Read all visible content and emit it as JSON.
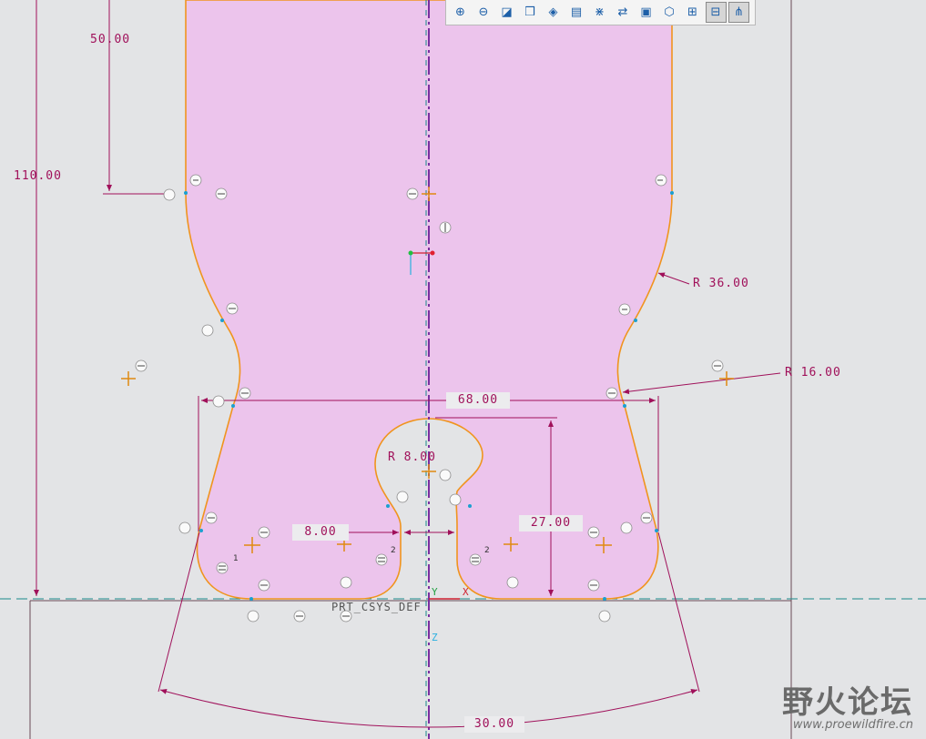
{
  "dimensions": {
    "d50": "50.00",
    "d110": "110.00",
    "d68": "68.00",
    "r36": "R 36.00",
    "r16": "R 16.00",
    "r8": "R 8.00",
    "d8": "8.00",
    "d27": "27.00",
    "d30": "30.00"
  },
  "csys_label": "PRT_CSYS_DEF",
  "axis_labels": {
    "y": "Y",
    "x": "X",
    "z": "Z"
  },
  "toolbar": {
    "buttons": [
      {
        "name": "zoom-in-icon",
        "glyph": "⊕"
      },
      {
        "name": "zoom-out-icon",
        "glyph": "⊖"
      },
      {
        "name": "refit-icon",
        "glyph": "◪"
      },
      {
        "name": "display-style-icon",
        "glyph": "❒"
      },
      {
        "name": "saved-views-icon",
        "glyph": "◈"
      },
      {
        "name": "view-manager-icon",
        "glyph": "▤"
      },
      {
        "name": "datum-display-icon",
        "glyph": "⋇"
      },
      {
        "name": "sketch-orientation-icon",
        "glyph": "⇄"
      },
      {
        "name": "shade-icon",
        "glyph": "▣"
      },
      {
        "name": "perspective-icon",
        "glyph": "⬡"
      },
      {
        "name": "sketcher-display-icon",
        "glyph": "⊞"
      },
      {
        "name": "constraints-display-icon",
        "glyph": "⊟"
      },
      {
        "name": "vertex-display-icon",
        "glyph": "⋔"
      }
    ]
  },
  "watermark": {
    "text": "野火论坛",
    "url": "www.proewildfire.cn"
  },
  "colors": {
    "background": "#e3e4e6",
    "fill": "#ecc4ec",
    "outline": "#f0941e",
    "dimension": "#a0105a",
    "centerline": "#7a2fa0",
    "dash": "#1a8a8a"
  }
}
